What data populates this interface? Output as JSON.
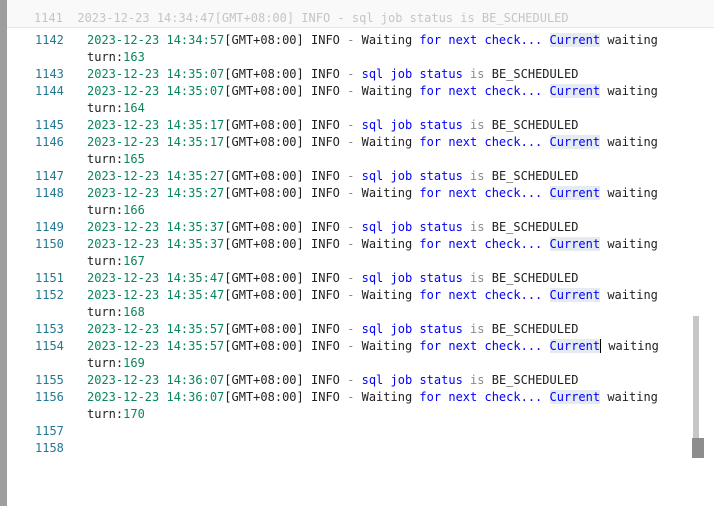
{
  "lines": [
    {
      "no": "1142",
      "ts": "2023-12-23 14:34:57",
      "kind": "wait",
      "turn": "163"
    },
    {
      "no": "1143",
      "ts": "2023-12-23 14:35:07",
      "kind": "status"
    },
    {
      "no": "1144",
      "ts": "2023-12-23 14:35:07",
      "kind": "wait",
      "turn": "164"
    },
    {
      "no": "1145",
      "ts": "2023-12-23 14:35:17",
      "kind": "status"
    },
    {
      "no": "1146",
      "ts": "2023-12-23 14:35:17",
      "kind": "wait",
      "turn": "165"
    },
    {
      "no": "1147",
      "ts": "2023-12-23 14:35:27",
      "kind": "status"
    },
    {
      "no": "1148",
      "ts": "2023-12-23 14:35:27",
      "kind": "wait",
      "turn": "166"
    },
    {
      "no": "1149",
      "ts": "2023-12-23 14:35:37",
      "kind": "status"
    },
    {
      "no": "1150",
      "ts": "2023-12-23 14:35:37",
      "kind": "wait",
      "turn": "167"
    },
    {
      "no": "1151",
      "ts": "2023-12-23 14:35:47",
      "kind": "status"
    },
    {
      "no": "1152",
      "ts": "2023-12-23 14:35:47",
      "kind": "wait",
      "turn": "168"
    },
    {
      "no": "1153",
      "ts": "2023-12-23 14:35:57",
      "kind": "status"
    },
    {
      "no": "1154",
      "ts": "2023-12-23 14:35:57",
      "kind": "wait",
      "turn": "169",
      "cursor": true
    },
    {
      "no": "1155",
      "ts": "2023-12-23 14:36:07",
      "kind": "status"
    },
    {
      "no": "1156",
      "ts": "2023-12-23 14:36:07",
      "kind": "wait",
      "turn": "170"
    },
    {
      "no": "1157",
      "kind": "empty"
    },
    {
      "no": "1158",
      "kind": "empty"
    }
  ],
  "tz": "[GMT+08:00]",
  "level": "INFO",
  "dash": "-",
  "status_text": {
    "w1": "sql",
    "w2": "job",
    "w3": "status",
    "w4": "is",
    "w5": "BE_SCHEDULED"
  },
  "wait_text": {
    "w1": "Waiting",
    "w2": "for",
    "w3": "next",
    "w4": "check...",
    "w5": "Current",
    "w6": "waiting",
    "turn_prefix": "turn:"
  },
  "partial_top": "1141  2023-12-23 14:34:47[GMT+08:00] INFO - sql job status is BE_SCHEDULED",
  "colors": {
    "line_number": "#237893",
    "timestamp": "#098658",
    "keyword": "#0000ff",
    "highlight": "#e5ebf1"
  }
}
